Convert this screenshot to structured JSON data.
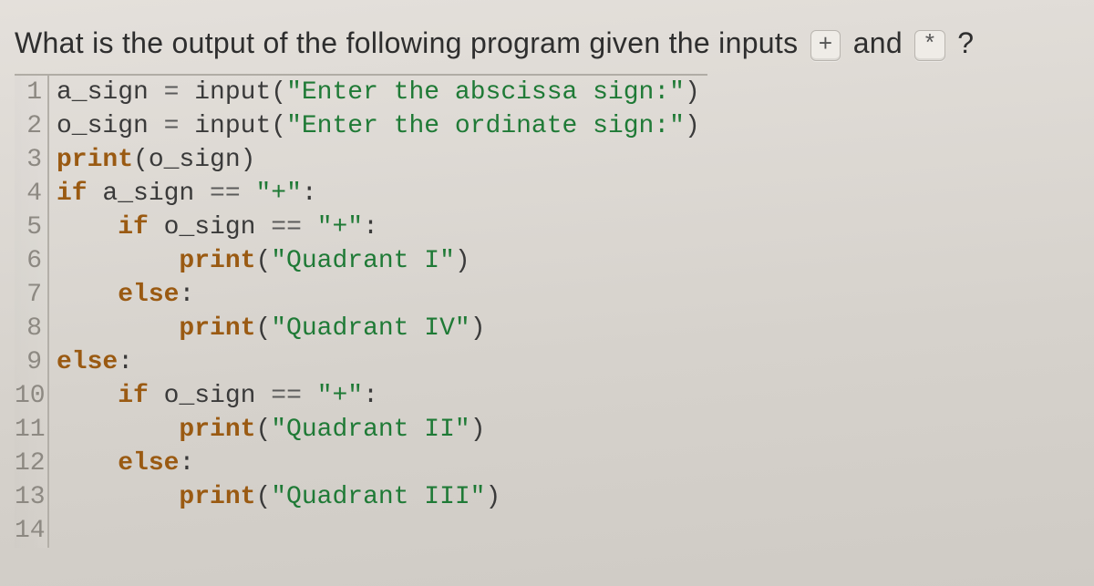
{
  "question": {
    "prefix": "What is the output of the following program given the inputs ",
    "input1": "+",
    "mid": " and ",
    "input2": "*",
    "suffix": " ?"
  },
  "code": {
    "lines": [
      {
        "n": "1",
        "segs": [
          {
            "t": "a_sign ",
            "c": "name"
          },
          {
            "t": "=",
            "c": "op"
          },
          {
            "t": " ",
            "c": "name"
          },
          {
            "t": "input",
            "c": "fn"
          },
          {
            "t": "(",
            "c": "pun"
          },
          {
            "t": "\"Enter the abscissa sign:\"",
            "c": "str"
          },
          {
            "t": ")",
            "c": "pun"
          }
        ]
      },
      {
        "n": "2",
        "segs": [
          {
            "t": "o_sign ",
            "c": "name"
          },
          {
            "t": "=",
            "c": "op"
          },
          {
            "t": " ",
            "c": "name"
          },
          {
            "t": "input",
            "c": "fn"
          },
          {
            "t": "(",
            "c": "pun"
          },
          {
            "t": "\"Enter the ordinate sign:\"",
            "c": "str"
          },
          {
            "t": ")",
            "c": "pun"
          }
        ]
      },
      {
        "n": "3",
        "segs": [
          {
            "t": "print",
            "c": "kw"
          },
          {
            "t": "(",
            "c": "pun"
          },
          {
            "t": "o_sign",
            "c": "name"
          },
          {
            "t": ")",
            "c": "pun"
          }
        ]
      },
      {
        "n": "4",
        "segs": [
          {
            "t": "if ",
            "c": "kw"
          },
          {
            "t": "a_sign ",
            "c": "name"
          },
          {
            "t": "==",
            "c": "op"
          },
          {
            "t": " ",
            "c": "name"
          },
          {
            "t": "\"+\"",
            "c": "str"
          },
          {
            "t": ":",
            "c": "pun"
          }
        ]
      },
      {
        "n": "5",
        "segs": [
          {
            "t": "    ",
            "c": "name"
          },
          {
            "t": "if ",
            "c": "kw"
          },
          {
            "t": "o_sign ",
            "c": "name"
          },
          {
            "t": "==",
            "c": "op"
          },
          {
            "t": " ",
            "c": "name"
          },
          {
            "t": "\"+\"",
            "c": "str"
          },
          {
            "t": ":",
            "c": "pun"
          }
        ]
      },
      {
        "n": "6",
        "segs": [
          {
            "t": "        ",
            "c": "name"
          },
          {
            "t": "print",
            "c": "kw"
          },
          {
            "t": "(",
            "c": "pun"
          },
          {
            "t": "\"Quadrant I\"",
            "c": "str"
          },
          {
            "t": ")",
            "c": "pun"
          }
        ]
      },
      {
        "n": "7",
        "segs": [
          {
            "t": "    ",
            "c": "name"
          },
          {
            "t": "else",
            "c": "kw"
          },
          {
            "t": ":",
            "c": "pun"
          }
        ]
      },
      {
        "n": "8",
        "segs": [
          {
            "t": "        ",
            "c": "name"
          },
          {
            "t": "print",
            "c": "kw"
          },
          {
            "t": "(",
            "c": "pun"
          },
          {
            "t": "\"Quadrant IV\"",
            "c": "str"
          },
          {
            "t": ")",
            "c": "pun"
          }
        ]
      },
      {
        "n": "9",
        "segs": [
          {
            "t": "else",
            "c": "kw"
          },
          {
            "t": ":",
            "c": "pun"
          }
        ]
      },
      {
        "n": "10",
        "segs": [
          {
            "t": "    ",
            "c": "name"
          },
          {
            "t": "if ",
            "c": "kw"
          },
          {
            "t": "o_sign ",
            "c": "name"
          },
          {
            "t": "==",
            "c": "op"
          },
          {
            "t": " ",
            "c": "name"
          },
          {
            "t": "\"+\"",
            "c": "str"
          },
          {
            "t": ":",
            "c": "pun"
          }
        ]
      },
      {
        "n": "11",
        "segs": [
          {
            "t": "        ",
            "c": "name"
          },
          {
            "t": "print",
            "c": "kw"
          },
          {
            "t": "(",
            "c": "pun"
          },
          {
            "t": "\"Quadrant II\"",
            "c": "str"
          },
          {
            "t": ")",
            "c": "pun"
          }
        ]
      },
      {
        "n": "12",
        "segs": [
          {
            "t": "    ",
            "c": "name"
          },
          {
            "t": "else",
            "c": "kw"
          },
          {
            "t": ":",
            "c": "pun"
          }
        ]
      },
      {
        "n": "13",
        "segs": [
          {
            "t": "        ",
            "c": "name"
          },
          {
            "t": "print",
            "c": "kw"
          },
          {
            "t": "(",
            "c": "pun"
          },
          {
            "t": "\"Quadrant III\"",
            "c": "str"
          },
          {
            "t": ")",
            "c": "pun"
          }
        ]
      },
      {
        "n": "14",
        "segs": []
      }
    ]
  }
}
